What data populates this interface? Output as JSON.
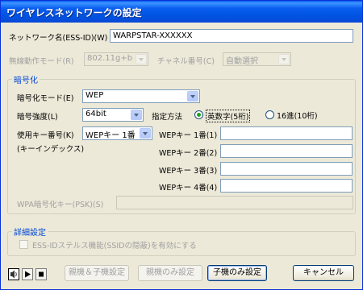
{
  "window": {
    "title": "ワイヤレスネットワークの設定"
  },
  "network_name": {
    "label": "ネットワーク名(ESS-ID)(W)",
    "value": "WARPSTAR-XXXXXX"
  },
  "wireless_mode": {
    "label": "無線動作モード(R)",
    "value": "802.11g+b"
  },
  "channel": {
    "label": "チャネル番号(C)",
    "value": "自動選択"
  },
  "encryption": {
    "group_title": "暗号化",
    "mode_label": "暗号化モード(E)",
    "mode_value": "WEP",
    "strength_label": "暗号強度(L)",
    "strength_value": "64bit",
    "method_label": "指定方法",
    "method_options": [
      "英数字(5桁)",
      "16進(10桁)"
    ],
    "key_number_label": "使用キー番号(K)",
    "key_number_sub": "(キーインデックス)",
    "key_number_value": "WEPキー 1番",
    "keys": [
      {
        "label": "WEPキー 1番(1)",
        "value": ""
      },
      {
        "label": "WEPキー 2番(2)",
        "value": ""
      },
      {
        "label": "WEPキー 3番(3)",
        "value": ""
      },
      {
        "label": "WEPキー 4番(4)",
        "value": ""
      }
    ],
    "wpa_label": "WPA暗号化キー(PSK)(S)",
    "wpa_value": ""
  },
  "details": {
    "group_title": "詳細設定",
    "stealth_label": "ESS-IDステルス機能(SSIDの隠蔽)を有効にする"
  },
  "buttons": {
    "parent_child": "親機＆子機設定",
    "parent_only": "親機のみ設定",
    "child_only": "子機のみ設定",
    "cancel": "キャンセル"
  }
}
